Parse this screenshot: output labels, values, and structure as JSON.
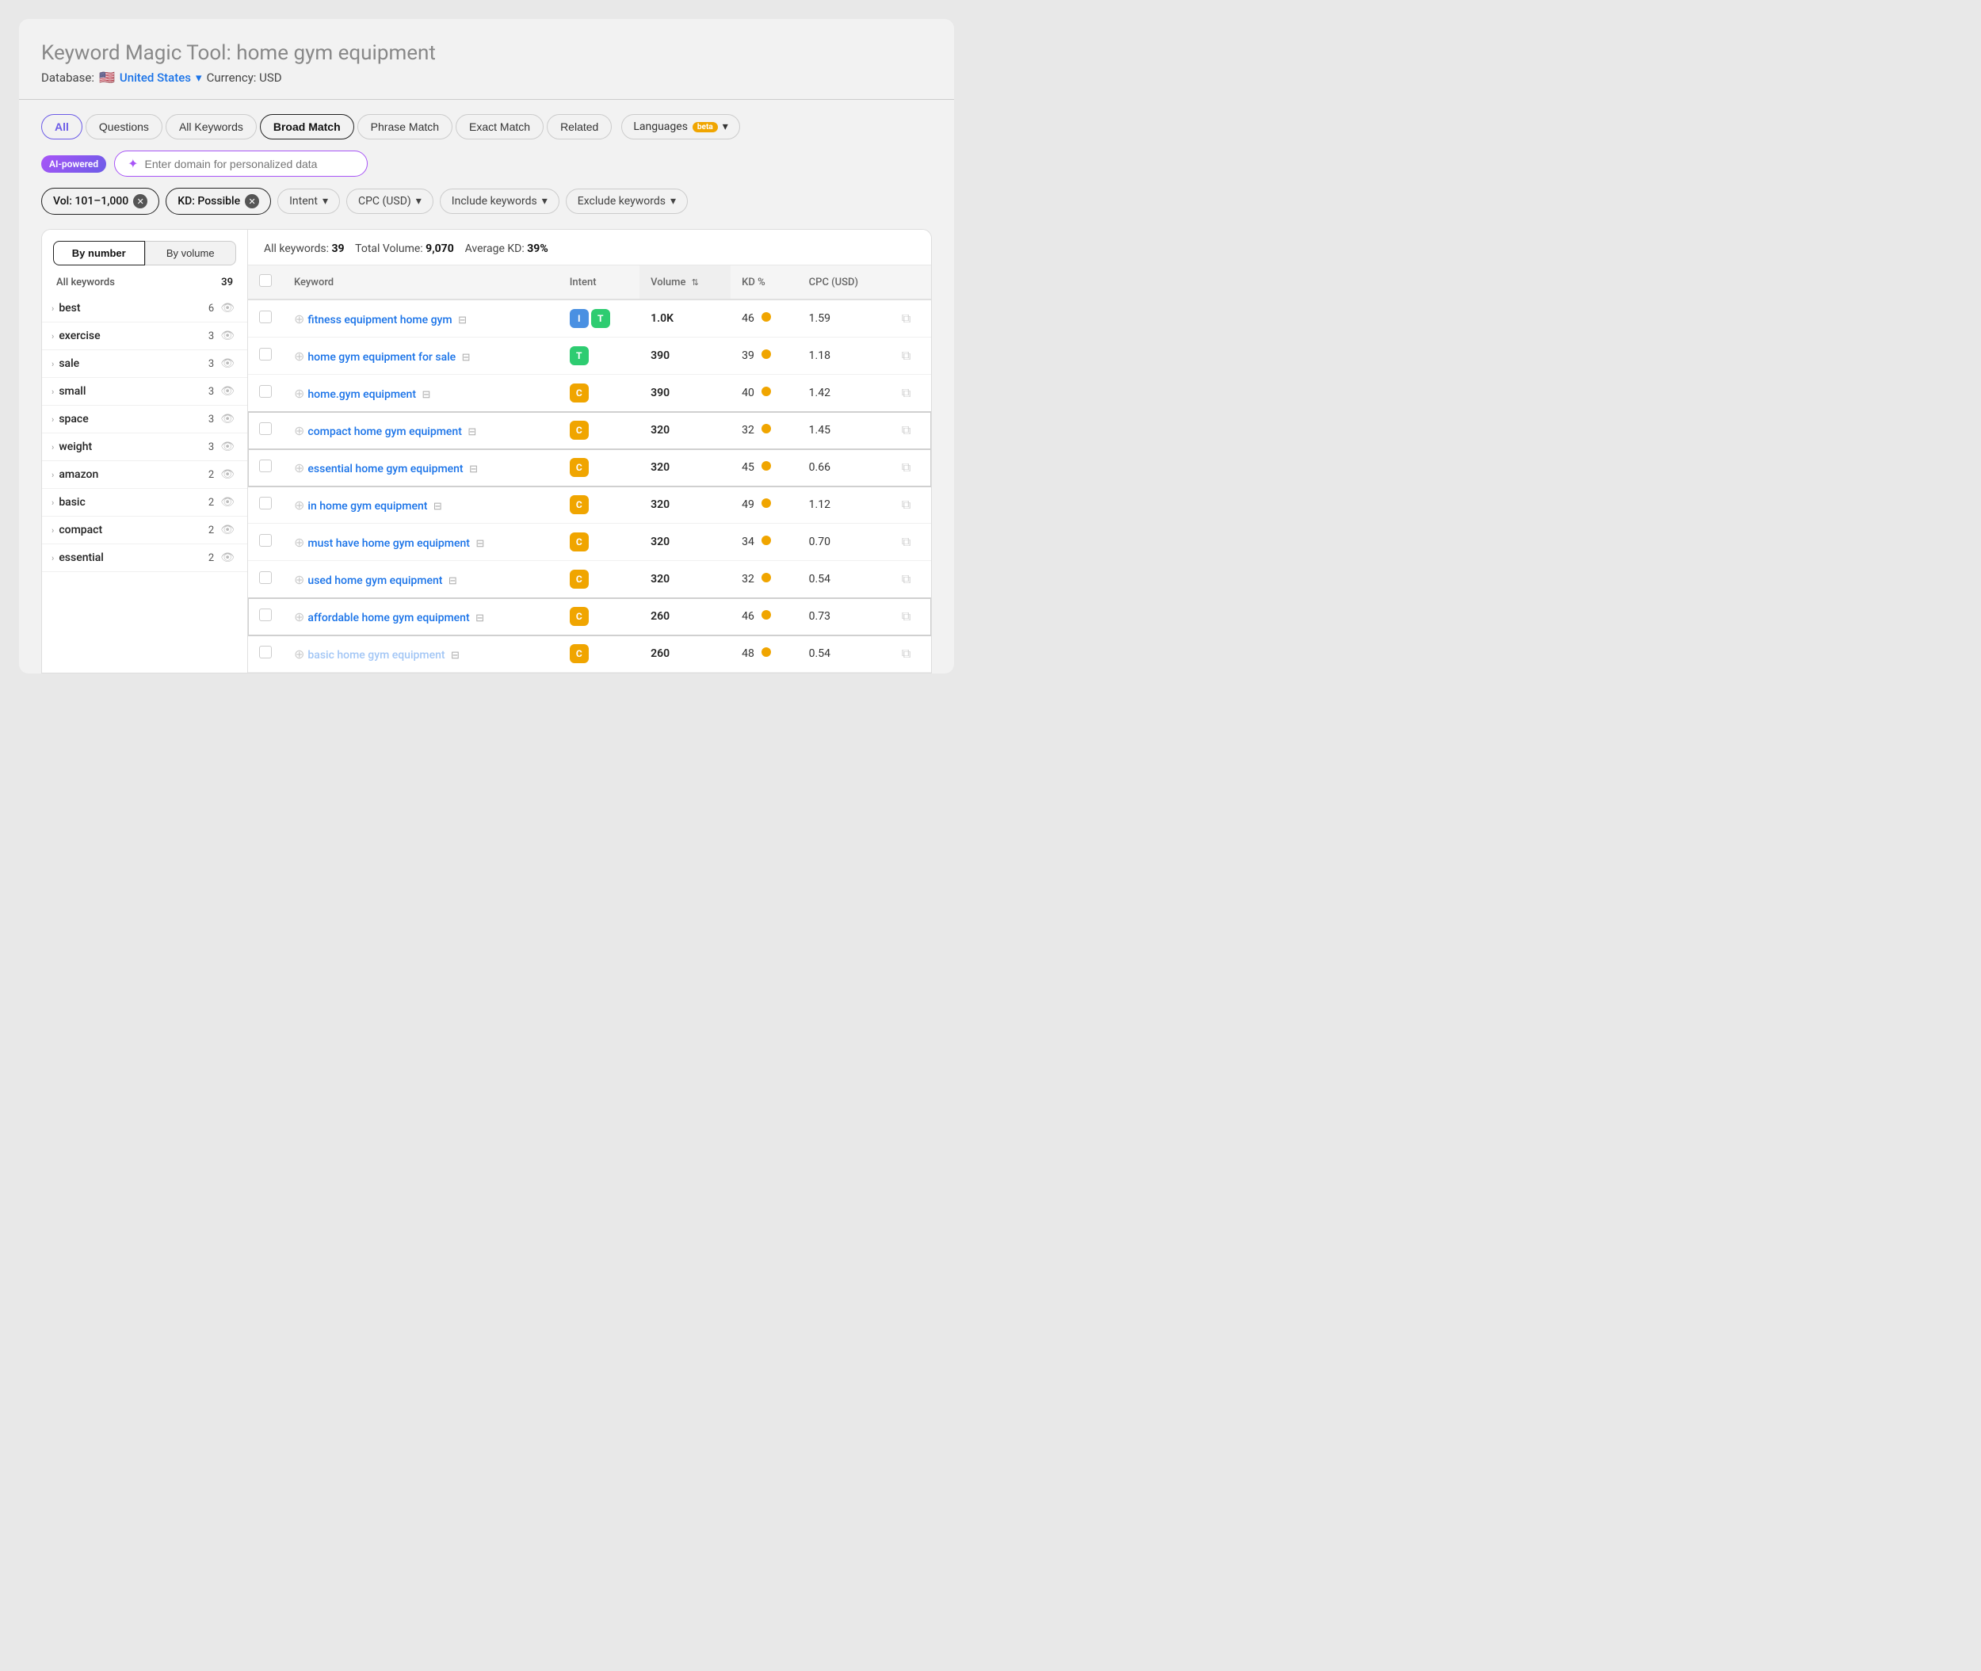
{
  "page": {
    "title": "Keyword Magic Tool:",
    "search_term": "home gym equipment",
    "database_label": "Database:",
    "database_country": "United States",
    "currency_label": "Currency: USD"
  },
  "tabs": [
    {
      "id": "all",
      "label": "All",
      "active": false,
      "selected_style": "all-active"
    },
    {
      "id": "questions",
      "label": "Questions",
      "active": false
    },
    {
      "id": "all-keywords",
      "label": "All Keywords",
      "active": false
    },
    {
      "id": "broad-match",
      "label": "Broad Match",
      "active": true
    },
    {
      "id": "phrase-match",
      "label": "Phrase Match",
      "active": false
    },
    {
      "id": "exact-match",
      "label": "Exact Match",
      "active": false
    },
    {
      "id": "related",
      "label": "Related",
      "active": false
    }
  ],
  "languages_btn": "Languages",
  "beta_badge": "beta",
  "ai_section": {
    "badge": "AI-powered",
    "placeholder": "Enter domain for personalized data",
    "icon": "✦"
  },
  "filters": {
    "vol_filter": "Vol: 101–1,000",
    "kd_filter": "KD: Possible",
    "intent_label": "Intent",
    "cpc_label": "CPC (USD)",
    "include_label": "Include keywords",
    "exclude_label": "Exclude keywords"
  },
  "sidebar": {
    "sort_by_number": "By number",
    "sort_by_volume": "By volume",
    "header_label": "All keywords",
    "header_count": "39",
    "items": [
      {
        "label": "best",
        "count": 6
      },
      {
        "label": "exercise",
        "count": 3
      },
      {
        "label": "sale",
        "count": 3
      },
      {
        "label": "small",
        "count": 3
      },
      {
        "label": "space",
        "count": 3
      },
      {
        "label": "weight",
        "count": 3
      },
      {
        "label": "amazon",
        "count": 2
      },
      {
        "label": "basic",
        "count": 2
      },
      {
        "label": "compact",
        "count": 2
      },
      {
        "label": "essential",
        "count": 2
      }
    ]
  },
  "table": {
    "summary": {
      "all_keywords_label": "All keywords:",
      "all_keywords_value": "39",
      "total_volume_label": "Total Volume:",
      "total_volume_value": "9,070",
      "avg_kd_label": "Average KD:",
      "avg_kd_value": "39%"
    },
    "columns": [
      "",
      "Keyword",
      "Intent",
      "Volume",
      "KD %",
      "CPC (USD)",
      ""
    ],
    "rows": [
      {
        "keyword": "fitness equipment home gym",
        "intents": [
          "I",
          "T"
        ],
        "volume": "1.0K",
        "kd": 46,
        "kd_color": "orange",
        "cpc": "1.59",
        "highlighted": false
      },
      {
        "keyword": "home gym equipment for sale",
        "intents": [
          "T"
        ],
        "volume": "390",
        "kd": 39,
        "kd_color": "orange",
        "cpc": "1.18",
        "highlighted": false
      },
      {
        "keyword": "home.gym equipment",
        "intents": [
          "C"
        ],
        "volume": "390",
        "kd": 40,
        "kd_color": "orange",
        "cpc": "1.42",
        "highlighted": false
      },
      {
        "keyword": "compact home gym equipment",
        "intents": [
          "C"
        ],
        "volume": "320",
        "kd": 32,
        "kd_color": "orange",
        "cpc": "1.45",
        "highlighted": true
      },
      {
        "keyword": "essential home gym equipment",
        "intents": [
          "C"
        ],
        "volume": "320",
        "kd": 45,
        "kd_color": "orange",
        "cpc": "0.66",
        "highlighted": true
      },
      {
        "keyword": "in home gym equipment",
        "intents": [
          "C"
        ],
        "volume": "320",
        "kd": 49,
        "kd_color": "orange",
        "cpc": "1.12",
        "highlighted": false
      },
      {
        "keyword": "must have home gym equipment",
        "intents": [
          "C"
        ],
        "volume": "320",
        "kd": 34,
        "kd_color": "orange",
        "cpc": "0.70",
        "highlighted": false
      },
      {
        "keyword": "used home gym equipment",
        "intents": [
          "C"
        ],
        "volume": "320",
        "kd": 32,
        "kd_color": "orange",
        "cpc": "0.54",
        "highlighted": false
      },
      {
        "keyword": "affordable home gym equipment",
        "intents": [
          "C"
        ],
        "volume": "260",
        "kd": 46,
        "kd_color": "orange",
        "cpc": "0.73",
        "highlighted": true
      },
      {
        "keyword": "basic home gym equipment",
        "intents": [
          "C"
        ],
        "volume": "260",
        "kd": 48,
        "kd_color": "orange",
        "cpc": "0.54",
        "highlighted": false,
        "faded": true
      }
    ]
  },
  "intent_colors": {
    "I": "#4a90e2",
    "T": "#2ecc71",
    "C": "#f0a500",
    "N": "#9b59b6"
  }
}
